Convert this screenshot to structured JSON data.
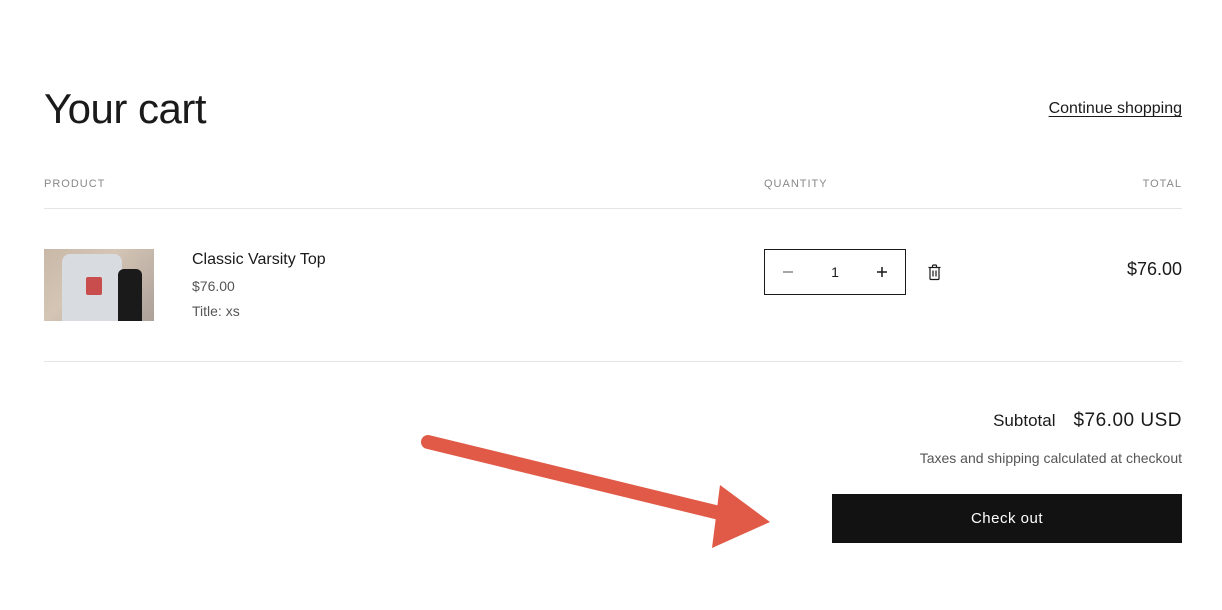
{
  "header": {
    "title": "Your cart",
    "continue_label": "Continue shopping"
  },
  "columns": {
    "product": "PRODUCT",
    "quantity": "QUANTITY",
    "total": "TOTAL"
  },
  "items": [
    {
      "name": "Classic Varsity Top",
      "price": "$76.00",
      "variant": "Title: xs",
      "quantity": "1",
      "line_total": "$76.00"
    }
  ],
  "footer": {
    "subtotal_label": "Subtotal",
    "subtotal_value": "$76.00 USD",
    "tax_note": "Taxes and shipping calculated at checkout",
    "checkout_label": "Check out"
  },
  "icons": {
    "minus": "minus-icon",
    "plus": "plus-icon",
    "trash": "trash-icon"
  },
  "annotation": {
    "arrow_color": "#e05a47"
  }
}
